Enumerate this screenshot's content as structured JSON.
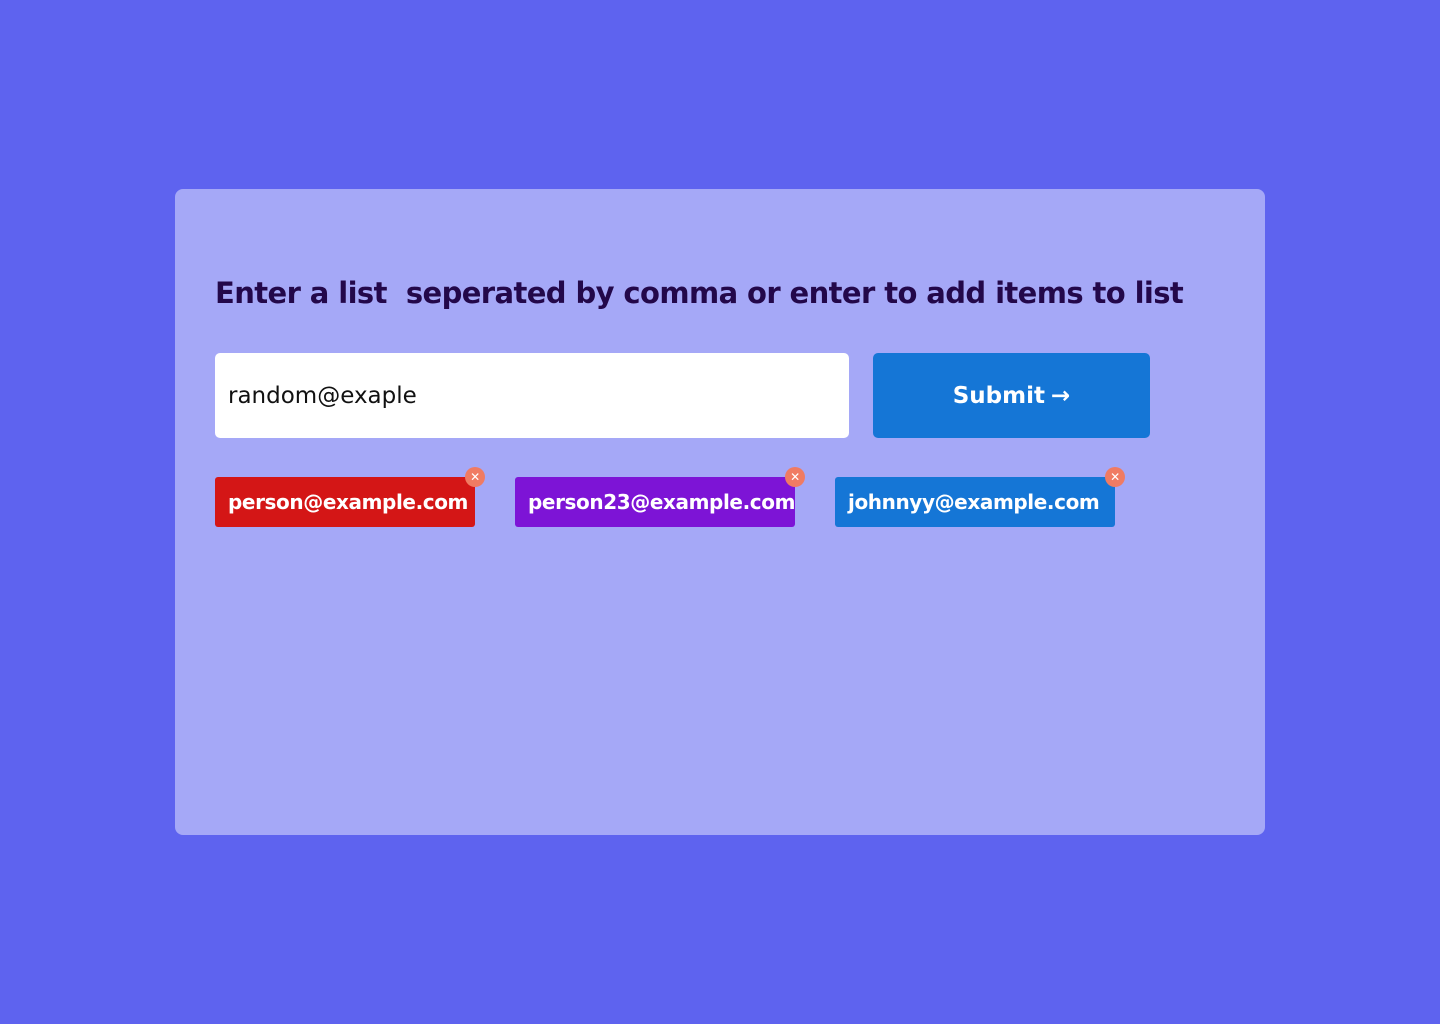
{
  "form": {
    "title": "Enter a list  seperated by comma or enter to add items to list",
    "input_value": "random@exaple",
    "submit_label": "Submit",
    "submit_arrow": "→"
  },
  "tags": [
    {
      "label": "person@example.com",
      "color": "#d41616"
    },
    {
      "label": "person23@example.com",
      "color": "#7d14d6"
    },
    {
      "label": "johnnyy@example.com",
      "color": "#1576d6"
    }
  ],
  "colors": {
    "background": "#5e63ef",
    "card": "#a5a8f7",
    "title": "#23084a",
    "submit": "#1576d6",
    "remove_badge": "#f07b63"
  },
  "icons": {
    "remove": "close-icon",
    "submit": "arrow-right-icon"
  }
}
